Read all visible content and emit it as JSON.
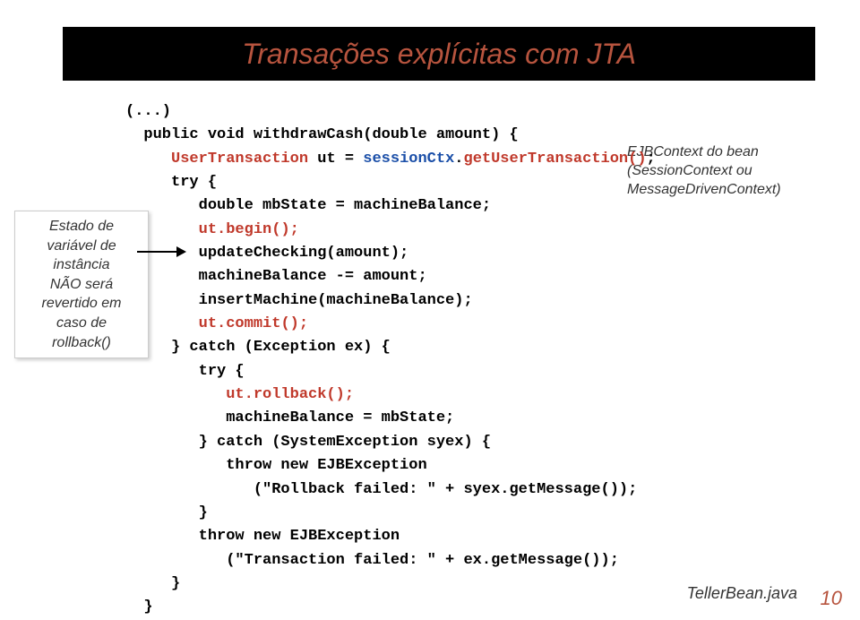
{
  "header": {
    "title": "Transações explícitas com JTA"
  },
  "annot_left": {
    "l1": "Estado de",
    "l2": "variável de",
    "l3": "instância",
    "l4": "NÃO será",
    "l5": "revertido em",
    "l6": "caso de",
    "l7": "rollback()"
  },
  "annot_right": {
    "l1": "EJBContext do bean",
    "l2": "(SessionContext ou",
    "l3": "MessageDrivenContext)"
  },
  "code": {
    "l01a": "(...)",
    "l02a": "  public void withdrawCash(double amount) {",
    "l03a": "     ",
    "l03b": "UserTransaction",
    "l03c": " ut = ",
    "l03d": "sessionCtx",
    "l03e": ".",
    "l03f": "getUserTransaction()",
    "l03g": ";",
    "l04a": "     try {",
    "l05a": "        double mbState = machineBalance;",
    "l06a": "        ",
    "l06b": "ut.begin();",
    "l07a": "        updateChecking(amount);",
    "l08a": "        machineBalance -= amount;",
    "l09a": "        insertMachine(machineBalance);",
    "l10a": "        ",
    "l10b": "ut.commit();",
    "l11a": "     } catch (Exception ex) {",
    "l12a": "        try {",
    "l13a": "           ",
    "l13b": "ut.rollback();",
    "l14a": "           machineBalance = mbState;",
    "l15a": "        } catch (SystemException syex) {",
    "l16a": "           throw new EJBException",
    "l17a": "              (\"Rollback failed: \" + syex.getMessage());",
    "l18a": "        }",
    "l19a": "        throw new EJBException",
    "l20a": "           (\"Transaction failed: \" + ex.getMessage());",
    "l21a": "     }",
    "l22a": "  }"
  },
  "footer": {
    "file": "TellerBean.java",
    "page": "10"
  }
}
